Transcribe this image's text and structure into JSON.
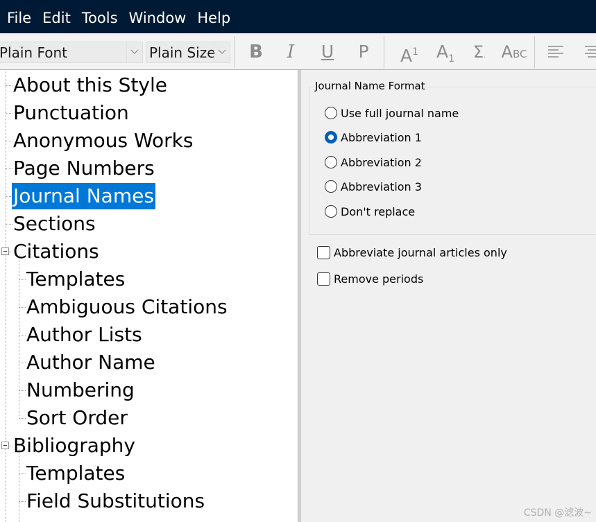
{
  "menu": [
    "File",
    "Edit",
    "Tools",
    "Window",
    "Help"
  ],
  "toolbar": {
    "font_combo": "Plain Font",
    "size_combo": "Plain Size",
    "bold": "B",
    "italic": "I",
    "underline": "U",
    "plain": "P",
    "superscript": "A",
    "superscript_mark": "1",
    "subscript": "A",
    "subscript_mark": "1",
    "symbol": "Σ",
    "small_caps_big": "A",
    "small_caps_small": "BC"
  },
  "tree": {
    "items": [
      {
        "label": "About this Style"
      },
      {
        "label": "Punctuation"
      },
      {
        "label": "Anonymous Works"
      },
      {
        "label": "Page Numbers"
      },
      {
        "label": "Journal Names",
        "selected": true
      },
      {
        "label": "Sections"
      },
      {
        "label": "Citations",
        "expanded": true,
        "children": [
          "Templates",
          "Ambiguous Citations",
          "Author Lists",
          "Author Name",
          "Numbering",
          "Sort Order"
        ]
      },
      {
        "label": "Bibliography",
        "expanded": true,
        "children": [
          "Templates",
          "Field Substitutions"
        ]
      }
    ]
  },
  "panel": {
    "group_title": "Journal Name Format",
    "options": [
      {
        "label": "Use full journal name",
        "checked": false
      },
      {
        "label": "Abbreviation 1",
        "checked": true
      },
      {
        "label": "Abbreviation 2",
        "checked": false
      },
      {
        "label": "Abbreviation 3",
        "checked": false
      },
      {
        "label": "Don't replace",
        "checked": false
      }
    ],
    "checkboxes": [
      {
        "label": "Abbreviate journal articles only",
        "checked": false
      },
      {
        "label": "Remove periods",
        "checked": false
      }
    ]
  },
  "watermark": "CSDN @滤波~",
  "colors": {
    "menubar_bg": "#001a35",
    "selection": "#0078d7",
    "radio_accent": "#005fb8"
  }
}
